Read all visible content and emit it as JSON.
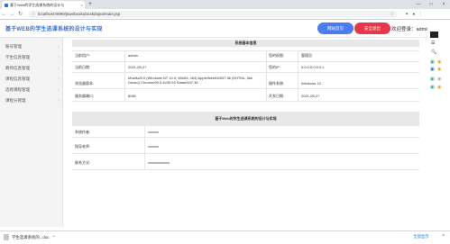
{
  "browser": {
    "tab_title": "基于Web的学生选课系统的设计与",
    "tab_close": "×",
    "new_tab": "+",
    "url": "localhost:8080/jsweboxkuboxkdxjxa/main.jsp",
    "window_controls": [
      "—",
      "□",
      "×"
    ]
  },
  "header": {
    "app_title": "基于WEB的学生选课系统的设计与实现",
    "home_button": "网站首页",
    "logout_button": "安全退出",
    "welcome_text": "欢迎登录：admin，管理员"
  },
  "sidebar": {
    "items": [
      {
        "label": "账号管理"
      },
      {
        "label": "学生信息管理"
      },
      {
        "label": "教师信息管理"
      },
      {
        "label": "课程信息管理"
      },
      {
        "label": "选修课程管理"
      },
      {
        "label": "课程分管理"
      }
    ]
  },
  "sysinfo": {
    "title": "系统基本信息",
    "rows": [
      {
        "k1": "当前用户:",
        "v1": "admin",
        "k2": "您的权限:",
        "v2": "管理员"
      },
      {
        "k1": "当前日期:",
        "v1": "2021-05-27",
        "k2": "您的IP:",
        "v2": "0:0:0:0:0:0:0:1"
      },
      {
        "k1": "浏览器版本:",
        "v1": "Mozilla/5.0 (Windows NT 10.0; Win64; x64) AppleWebKit/537.36 (KHTML, like Gecko) Chrome/90.0.4430.93 Safari/537.36",
        "k2": "操作系统:",
        "v2": "Windows 10"
      },
      {
        "k1": "服务器端口:",
        "v1": "8080",
        "k2": "开发日期:",
        "v2": "2021-05-27"
      }
    ]
  },
  "devinfo": {
    "title": "基于Web的学生选课系统的设计与实现",
    "rows": [
      {
        "k": "系统作者:",
        "v": "xxxxxx"
      },
      {
        "k": "指导老师:",
        "v": "xxxxxx"
      },
      {
        "k": "联系方式:",
        "v": "xxxxxxxxxxxx"
      }
    ]
  },
  "download": {
    "file_name": "学生选课系统的...doc",
    "show_all": "全部显示",
    "close": "×"
  }
}
